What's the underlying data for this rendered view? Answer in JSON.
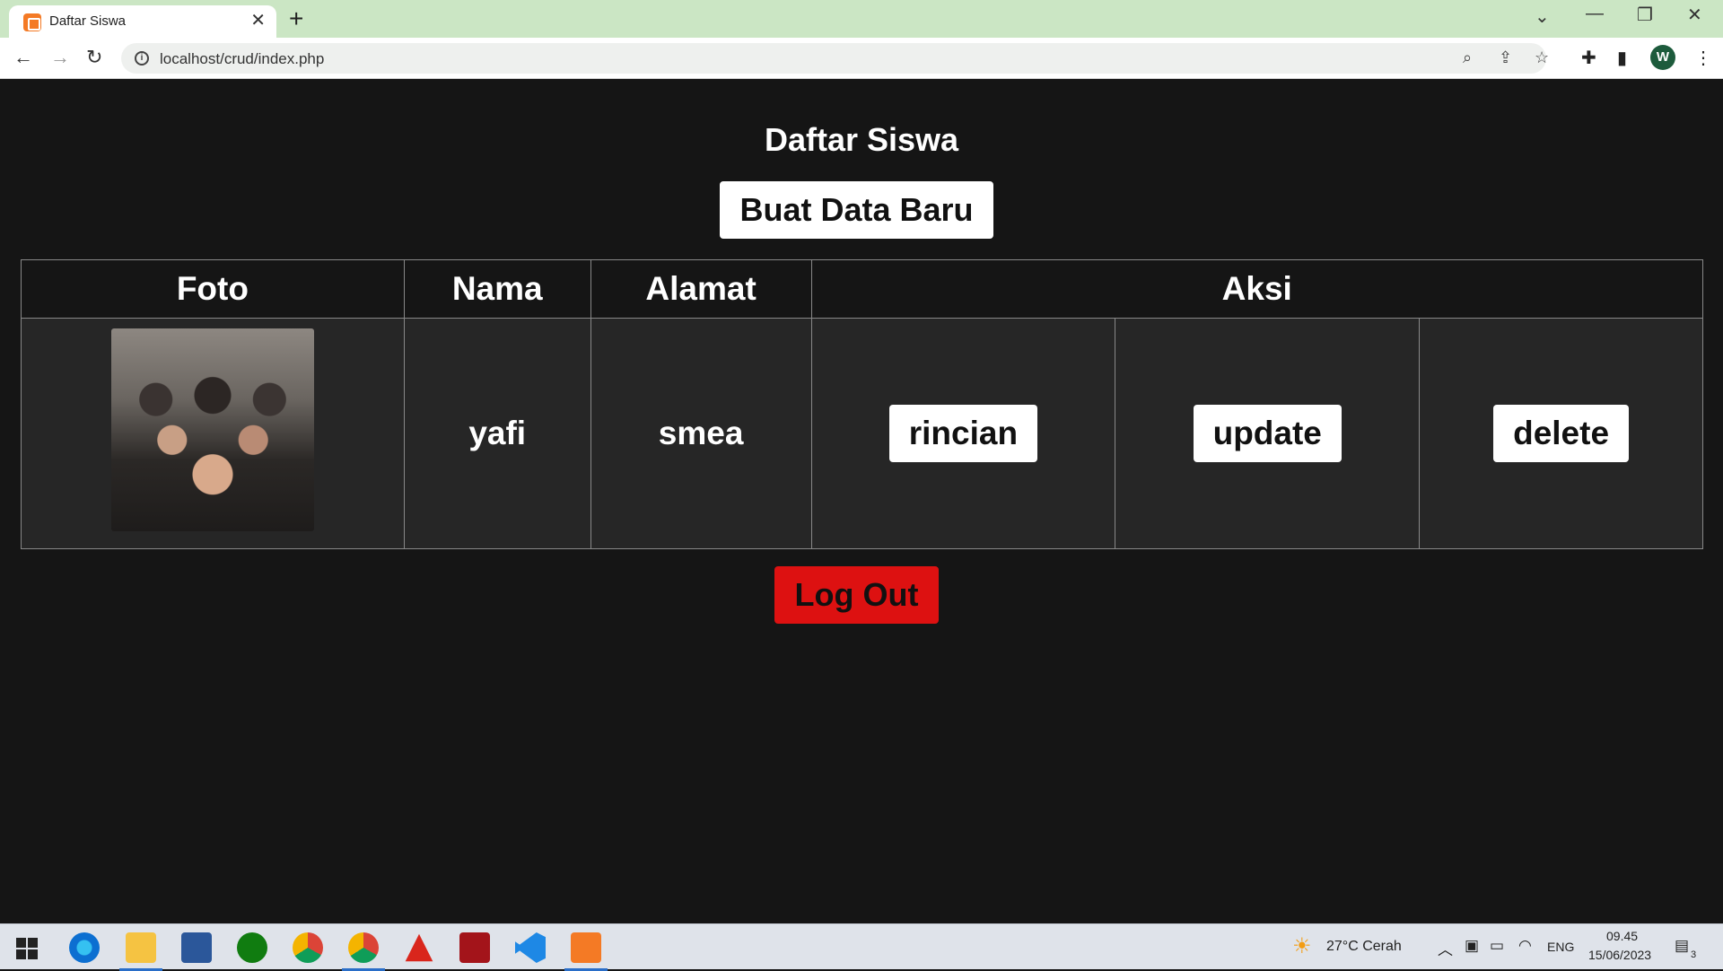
{
  "browser": {
    "tab_title": "Daftar Siswa",
    "url": "localhost/crud/index.php",
    "profile_initial": "W"
  },
  "page": {
    "title": "Daftar Siswa",
    "new_button": "Buat Data Baru",
    "table": {
      "headers": [
        "Foto",
        "Nama",
        "Alamat",
        "Aksi"
      ],
      "rows": [
        {
          "nama": "yafi",
          "alamat": "smea",
          "actions": [
            "rincian",
            "update",
            "delete"
          ]
        }
      ]
    },
    "logout_button": "Log Out"
  },
  "taskbar": {
    "weather": "27°C  Cerah",
    "language": "ENG",
    "time": "09.45",
    "date": "15/06/2023",
    "notifications": "3",
    "apps": [
      "edge-icon",
      "file-explorer-icon",
      "word-icon",
      "xbox-icon",
      "chrome-icon",
      "chrome-profile-icon",
      "acrobat-icon",
      "app-red-icon",
      "vscode-icon",
      "xampp-icon"
    ]
  },
  "colors": {
    "page_bg": "#151515",
    "row_bg": "#262626",
    "logout_red": "#dd1111",
    "tabstrip": "#cbe6c4"
  }
}
